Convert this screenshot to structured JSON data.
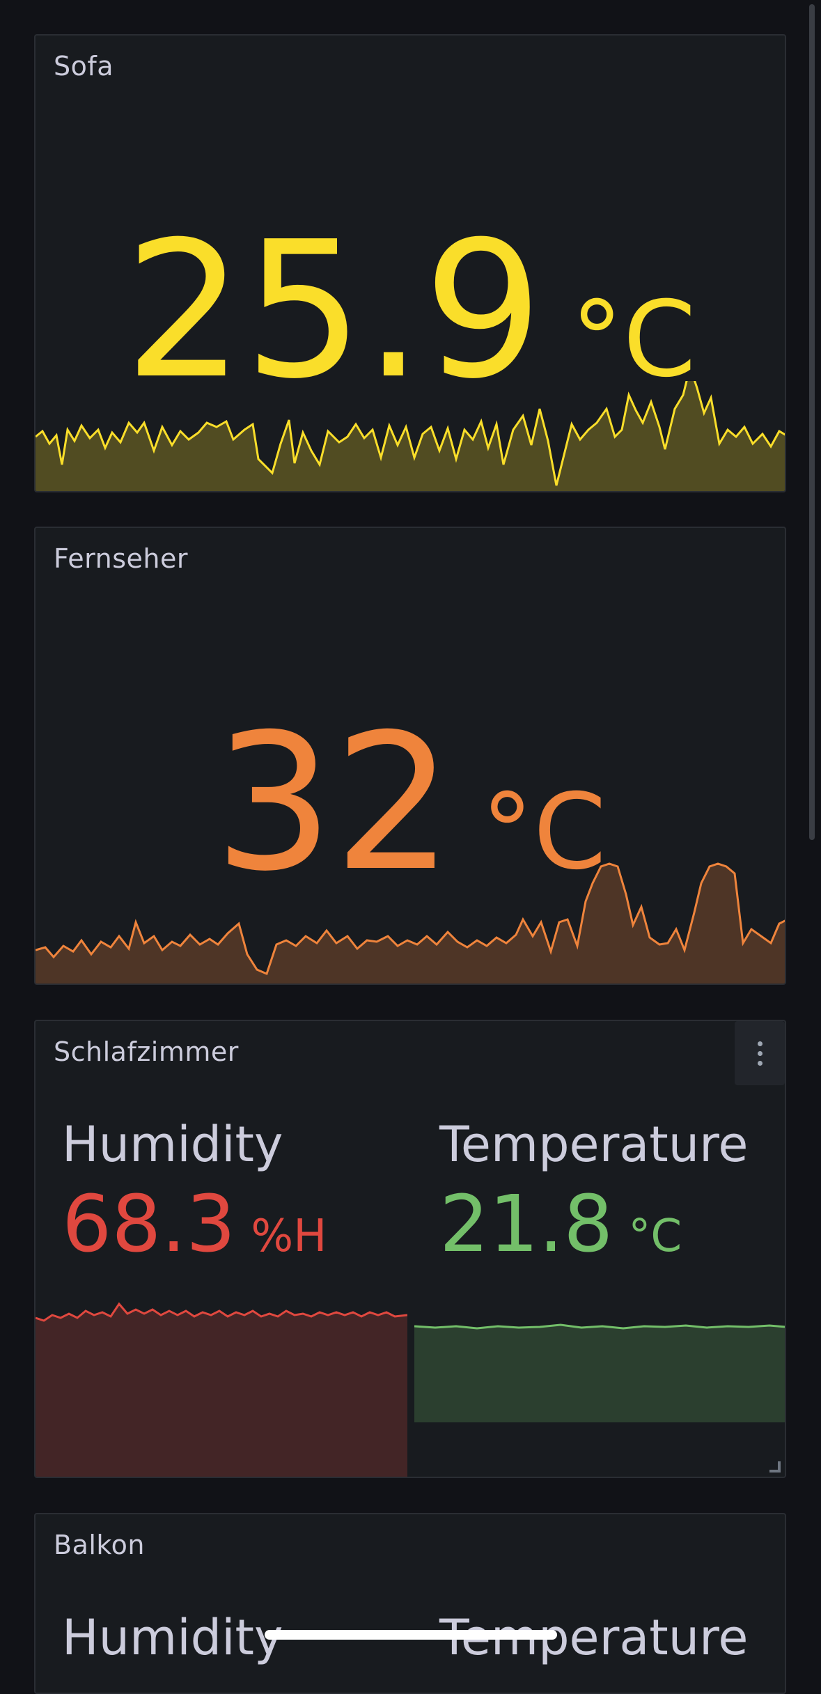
{
  "colors": {
    "background": "#111217",
    "panel": "#181b1f",
    "sofa": "#fade2a",
    "fernseher": "#ef843c",
    "humidity": "#e0483f",
    "temperature": "#73bf69"
  },
  "panels": [
    {
      "title": "Sofa",
      "value": "25.9",
      "unit": "°C"
    },
    {
      "title": "Fernseher",
      "value": "32",
      "unit": "°C"
    },
    {
      "title": "Schlafzimmer",
      "menu_icon": "more-vertical-icon",
      "stats": [
        {
          "label": "Humidity",
          "value": "68.3",
          "unit": "%H"
        },
        {
          "label": "Temperature",
          "value": "21.8",
          "unit": "°C"
        }
      ]
    },
    {
      "title": "Balkon",
      "stats": [
        {
          "label": "Humidity"
        },
        {
          "label": "Temperature"
        }
      ]
    }
  ]
}
